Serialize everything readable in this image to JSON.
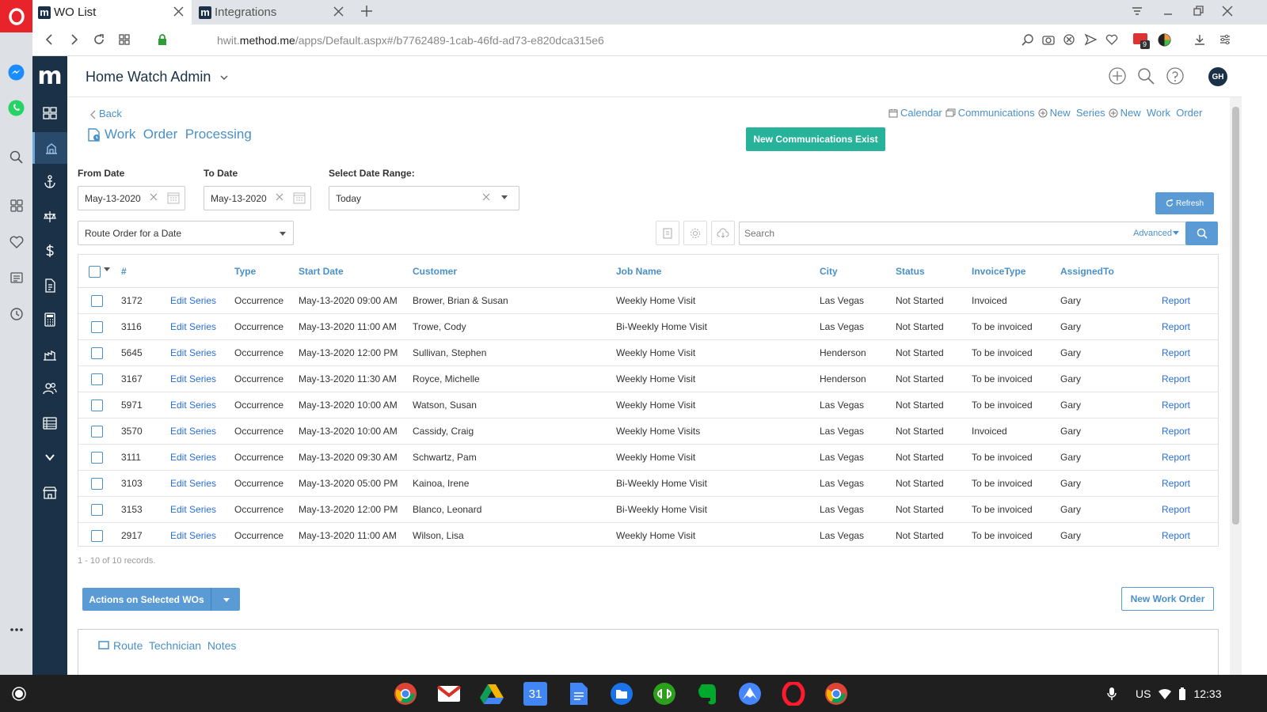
{
  "browser": {
    "tabs": [
      {
        "label": "WO List",
        "favicon": "m"
      },
      {
        "label": "Integrations",
        "favicon": "m"
      }
    ],
    "url_host": "hwit.",
    "url_domain": "method.me",
    "url_path": "/apps/Default.aspx#/b7762489-1cab-46fd-ad73-e820dca315e6",
    "ext_badge": "9"
  },
  "app": {
    "logo": "m",
    "title": "Home Watch Admin",
    "avatar": "GH"
  },
  "page": {
    "back": "Back",
    "title": "Work  Order  Processing",
    "links": [
      "Calendar",
      "Communications",
      "New  Series",
      "New  Work  Order"
    ],
    "new_comm_button": "New Communications Exist",
    "refresh": "Refresh"
  },
  "filters": {
    "from_label": "From Date",
    "from_value": "May-13-2020",
    "to_label": "To Date",
    "to_value": "May-13-2020",
    "range_label": "Select Date Range:",
    "range_value": "Today",
    "route_value": "Route Order for a Date",
    "search_placeholder": "Search",
    "advanced": "Advanced"
  },
  "table": {
    "headers": [
      "#",
      "Type",
      "Start Date",
      "Customer",
      "Job Name",
      "City",
      "Status",
      "InvoiceType",
      "AssignedTo"
    ],
    "rows": [
      {
        "num": "3172",
        "edit": "Edit Series",
        "type": "Occurrence",
        "start": "May-13-2020 09:00 AM",
        "customer": "Brower, Brian & Susan",
        "job": "Weekly Home Visit",
        "city": "Las Vegas",
        "status": "Not Started",
        "invoice": "Invoiced",
        "assigned": "Gary",
        "report": "Report"
      },
      {
        "num": "3116",
        "edit": "Edit Series",
        "type": "Occurrence",
        "start": "May-13-2020 11:00 AM",
        "customer": "Trowe, Cody",
        "job": "Bi-Weekly Home Visit",
        "city": "Las Vegas",
        "status": "Not Started",
        "invoice": "To be invoiced",
        "assigned": "Gary",
        "report": "Report"
      },
      {
        "num": "5645",
        "edit": "Edit Series",
        "type": "Occurrence",
        "start": "May-13-2020 12:00 PM",
        "customer": "Sullivan, Stephen",
        "job": "Weekly Home Visit",
        "city": "Henderson",
        "status": "Not Started",
        "invoice": "To be invoiced",
        "assigned": "Gary",
        "report": "Report"
      },
      {
        "num": "3167",
        "edit": "Edit Series",
        "type": "Occurrence",
        "start": "May-13-2020 11:30 AM",
        "customer": "Royce, Michelle",
        "job": "Weekly Home Visit",
        "city": "Henderson",
        "status": "Not Started",
        "invoice": "To be invoiced",
        "assigned": "Gary",
        "report": "Report"
      },
      {
        "num": "5971",
        "edit": "Edit Series",
        "type": "Occurrence",
        "start": "May-13-2020 10:00 AM",
        "customer": "Watson, Susan",
        "job": "Weekly Home Visit",
        "city": "Las Vegas",
        "status": "Not Started",
        "invoice": "To be invoiced",
        "assigned": "Gary",
        "report": "Report"
      },
      {
        "num": "3570",
        "edit": "Edit Series",
        "type": "Occurrence",
        "start": "May-13-2020 10:00 AM",
        "customer": "Cassidy, Craig",
        "job": "Weekly Home Visits",
        "city": "Las Vegas",
        "status": "Not Started",
        "invoice": "Invoiced",
        "assigned": "Gary",
        "report": "Report"
      },
      {
        "num": "3111",
        "edit": "Edit Series",
        "type": "Occurrence",
        "start": "May-13-2020 09:30 AM",
        "customer": "Schwartz, Pam",
        "job": "Weekly Home Visit",
        "city": "Las Vegas",
        "status": "Not Started",
        "invoice": "To be invoiced",
        "assigned": "Gary",
        "report": "Report"
      },
      {
        "num": "3103",
        "edit": "Edit Series",
        "type": "Occurrence",
        "start": "May-13-2020 05:00 PM",
        "customer": "Kainoa, Irene",
        "job": "Bi-Weekly Home Visit",
        "city": "Las Vegas",
        "status": "Not Started",
        "invoice": "To be invoiced",
        "assigned": "Gary",
        "report": "Report"
      },
      {
        "num": "3153",
        "edit": "Edit Series",
        "type": "Occurrence",
        "start": "May-13-2020 12:00 PM",
        "customer": "Blanco, Leonard",
        "job": "Bi-Weekly Home Visit",
        "city": "Las Vegas",
        "status": "Not Started",
        "invoice": "To be invoiced",
        "assigned": "Gary",
        "report": "Report"
      },
      {
        "num": "2917",
        "edit": "Edit Series",
        "type": "Occurrence",
        "start": "May-13-2020 11:00 AM",
        "customer": "Wilson, Lisa",
        "job": "Weekly Home Visit",
        "city": "Las Vegas",
        "status": "Not Started",
        "invoice": "To be invoiced",
        "assigned": "Gary",
        "report": "Report"
      }
    ],
    "records": "1 - 10 of 10 records."
  },
  "footer": {
    "actions": "Actions on Selected WOs",
    "new_wo": "New Work Order",
    "notes": "Route  Technician  Notes"
  },
  "taskbar": {
    "calendar_day": "31",
    "locale": "US",
    "time": "12:33"
  },
  "colors": {
    "accent": "#4a90c8",
    "sidebar": "#1b3147",
    "green_button": "#26b39a",
    "link": "#2a6fd6"
  }
}
